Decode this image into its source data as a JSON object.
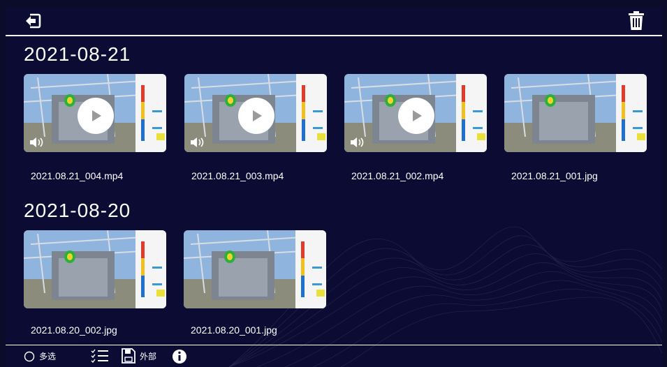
{
  "header": {
    "back_icon": "back-exit-icon",
    "delete_icon": "trash-icon"
  },
  "groups": [
    {
      "date": "2021-08-21",
      "items": [
        {
          "name": "2021.08.21_004.mp4",
          "type": "video"
        },
        {
          "name": "2021.08.21_003.mp4",
          "type": "video"
        },
        {
          "name": "2021.08.21_002.mp4",
          "type": "video"
        },
        {
          "name": "2021.08.21_001.jpg",
          "type": "image"
        }
      ]
    },
    {
      "date": "2021-08-20",
      "items": [
        {
          "name": "2021.08.20_002.jpg",
          "type": "image"
        },
        {
          "name": "2021.08.20_001.jpg",
          "type": "image"
        }
      ]
    }
  ],
  "footer": {
    "multi_select_label": "多选",
    "external_label": "外部",
    "list_icon": "checklist-icon",
    "save_icon": "save-disk-icon",
    "info_icon": "info-icon"
  },
  "colors": {
    "background": "#0b0b33",
    "foreground": "#ffffff"
  }
}
